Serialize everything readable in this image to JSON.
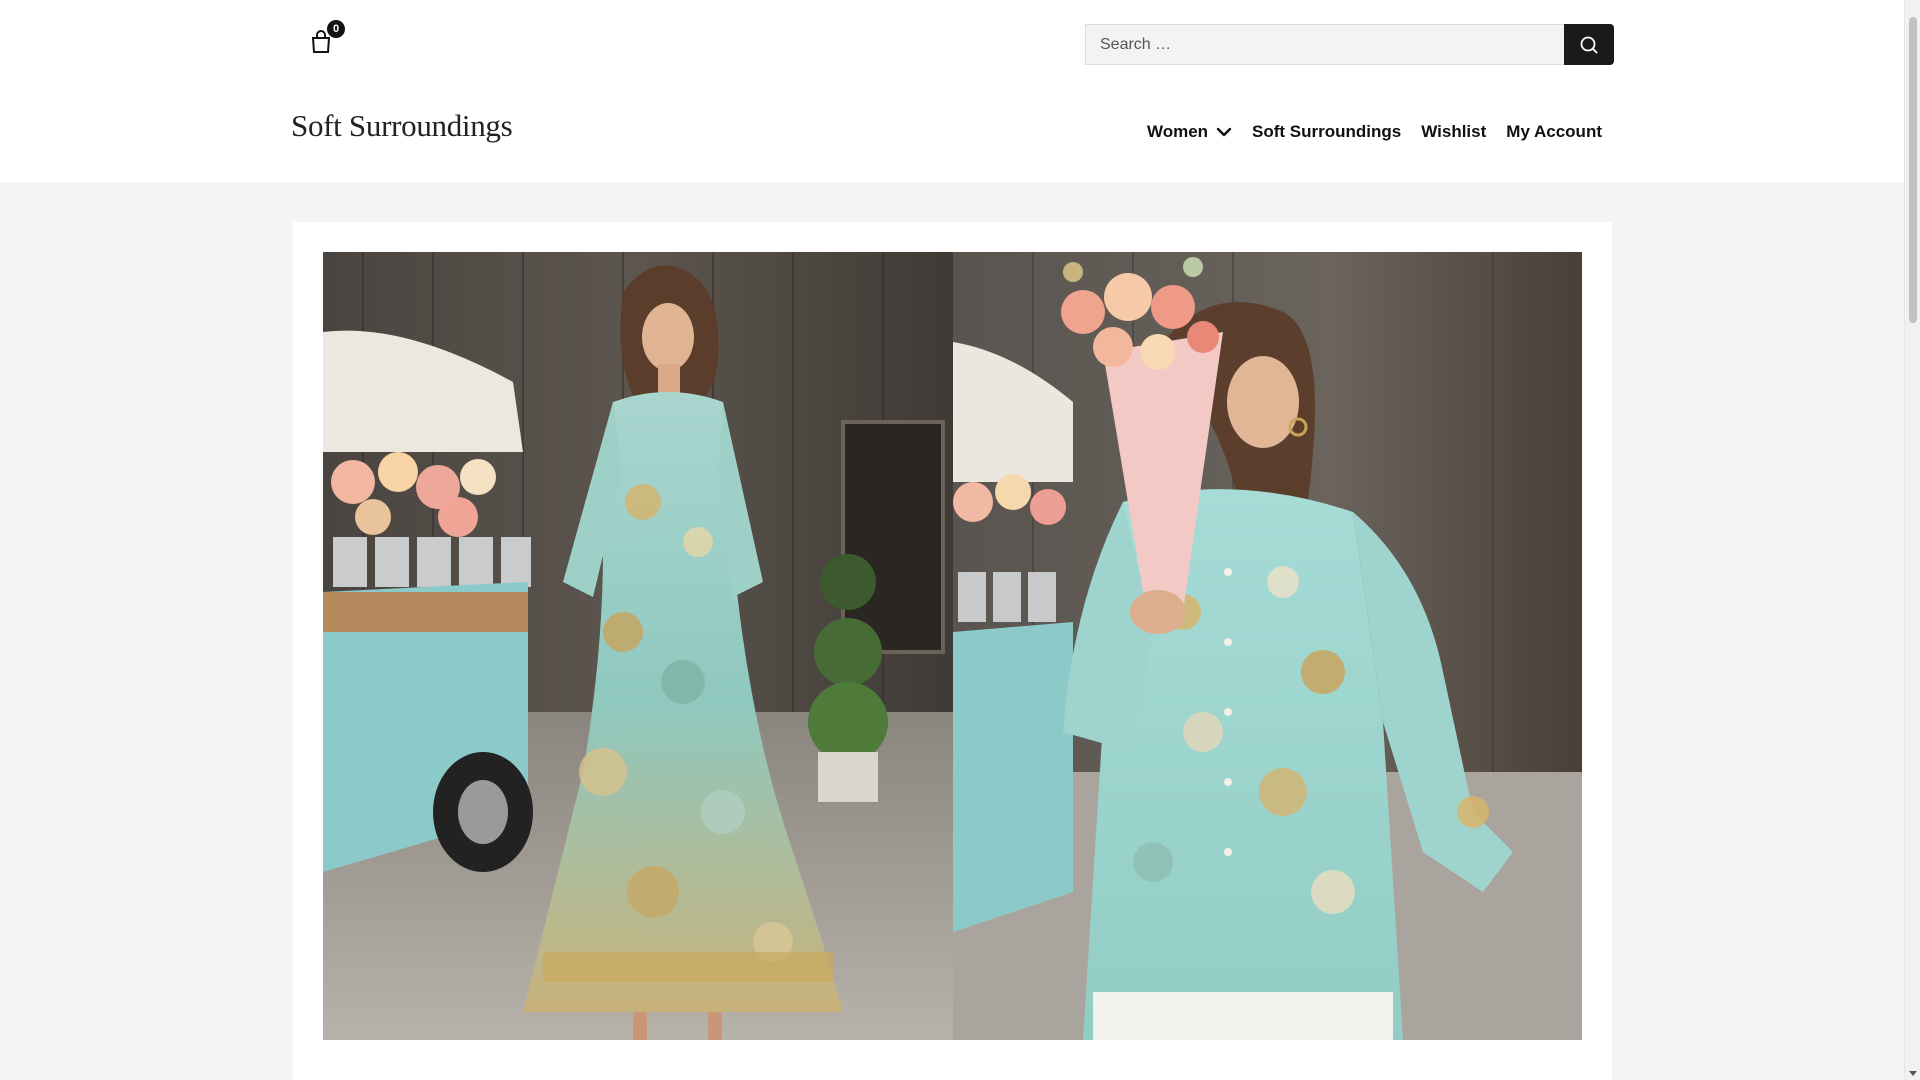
{
  "cart": {
    "count": "0"
  },
  "search": {
    "placeholder": "Search …",
    "value": ""
  },
  "logo": {
    "text": "Soft Surroundings"
  },
  "nav": {
    "items": [
      {
        "label": "Women",
        "has_dropdown": true
      },
      {
        "label": "Soft Surroundings"
      },
      {
        "label": "Wishlist"
      },
      {
        "label": "My Account"
      }
    ]
  },
  "hero": {
    "panels": [
      {
        "subject": "woman-in-floral-tiered-maxi-dress",
        "accent": "#9fd8d6"
      },
      {
        "subject": "woman-holding-pink-bouquet-floral-blouse",
        "accent": "#a8dcd6"
      }
    ]
  },
  "colors": {
    "header_bg": "#ffffff",
    "page_bg": "#f5f5f5",
    "search_button": "#1a1a1a",
    "text": "#111111"
  }
}
